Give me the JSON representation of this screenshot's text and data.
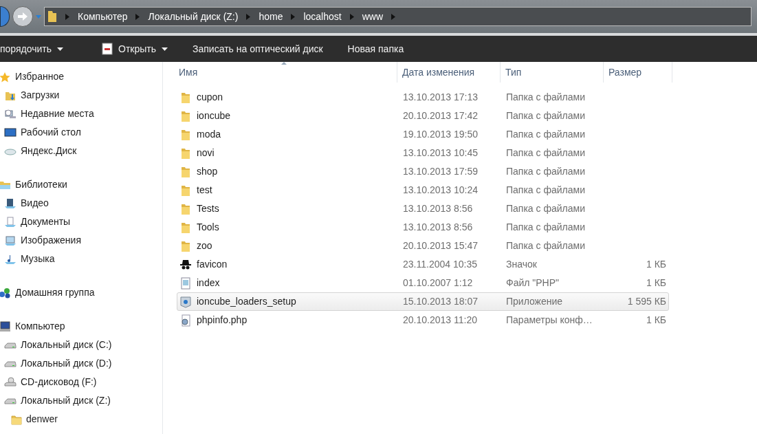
{
  "address_bar": {
    "path": [
      "Компьютер",
      "Локальный диск (Z:)",
      "home",
      "localhost",
      "www"
    ]
  },
  "toolbar": [
    {
      "label": "порядочить",
      "dropdown": true,
      "kind": "text"
    },
    {
      "label": "Открыть",
      "dropdown": true,
      "kind": "open"
    },
    {
      "label": "Записать на оптический диск",
      "dropdown": false,
      "kind": "text"
    },
    {
      "label": "Новая папка",
      "dropdown": false,
      "kind": "text"
    }
  ],
  "sidebar": {
    "groups": [
      {
        "label": "Избранное",
        "kind": "star",
        "children": [
          {
            "label": "Загрузки",
            "kind": "downloads"
          },
          {
            "label": "Недавние места",
            "kind": "recent"
          },
          {
            "label": "Рабочий стол",
            "kind": "desktop"
          },
          {
            "label": "Яндекс.Диск",
            "kind": "cloud"
          }
        ]
      },
      {
        "label": "Библиотеки",
        "kind": "library",
        "children": [
          {
            "label": "Видео",
            "kind": "video"
          },
          {
            "label": "Документы",
            "kind": "docs"
          },
          {
            "label": "Изображения",
            "kind": "images"
          },
          {
            "label": "Музыка",
            "kind": "music"
          }
        ]
      },
      {
        "label": "Домашняя группа",
        "kind": "homegroup"
      },
      {
        "label": "Компьютер",
        "kind": "computer",
        "children": [
          {
            "label": "Локальный диск (C:)",
            "kind": "drive"
          },
          {
            "label": "Локальный диск (D:)",
            "kind": "drive"
          },
          {
            "label": "CD-дисковод (F:)",
            "kind": "cd"
          },
          {
            "label": "Локальный диск (Z:)",
            "kind": "drive",
            "children": [
              {
                "label": "denwer",
                "kind": "folder"
              }
            ]
          }
        ]
      }
    ]
  },
  "table": {
    "columns": [
      "Имя",
      "Дата изменения",
      "Тип",
      "Размер"
    ],
    "rows": [
      {
        "kind": "folder",
        "name": "cupon",
        "date": "13.10.2013 17:13",
        "type": "Папка с файлами",
        "selected": false
      },
      {
        "kind": "folder",
        "name": "ioncube",
        "date": "20.10.2013 17:42",
        "type": "Папка с файлами",
        "selected": false
      },
      {
        "kind": "folder",
        "name": "moda",
        "date": "19.10.2013 19:50",
        "type": "Папка с файлами",
        "selected": false
      },
      {
        "kind": "folder",
        "name": "novi",
        "date": "13.10.2013 10:45",
        "type": "Папка с файлами",
        "selected": false
      },
      {
        "kind": "folder",
        "name": "shop",
        "date": "13.10.2013 17:59",
        "type": "Папка с файлами",
        "selected": false
      },
      {
        "kind": "folder",
        "name": "test",
        "date": "13.10.2013 10:24",
        "type": "Папка с файлами",
        "selected": false
      },
      {
        "kind": "folder",
        "name": "Tests",
        "date": "13.10.2013 8:56",
        "type": "Папка с файлами",
        "selected": false
      },
      {
        "kind": "folder",
        "name": "Tools",
        "date": "13.10.2013 8:56",
        "type": "Папка с файлами",
        "selected": false
      },
      {
        "kind": "folder",
        "name": "zoo",
        "date": "20.10.2013 15:47",
        "type": "Папка с файлами",
        "selected": false
      },
      {
        "kind": "icon",
        "name": "favicon",
        "date": "23.11.2004 10:35",
        "type": "Значок",
        "size": "1 КБ",
        "selected": false
      },
      {
        "kind": "php",
        "name": "index",
        "date": "01.10.2007 1:12",
        "type": "Файл \"PHP\"",
        "size": "1 КБ",
        "selected": false
      },
      {
        "kind": "app",
        "name": "ioncube_loaders_setup",
        "date": "15.10.2013 18:07",
        "type": "Приложение",
        "size": "1 595 КБ",
        "selected": true
      },
      {
        "kind": "config",
        "name": "phpinfo.php",
        "date": "20.10.2013 11:20",
        "type": "Параметры конф…",
        "size": "1 КБ",
        "selected": false
      }
    ]
  }
}
